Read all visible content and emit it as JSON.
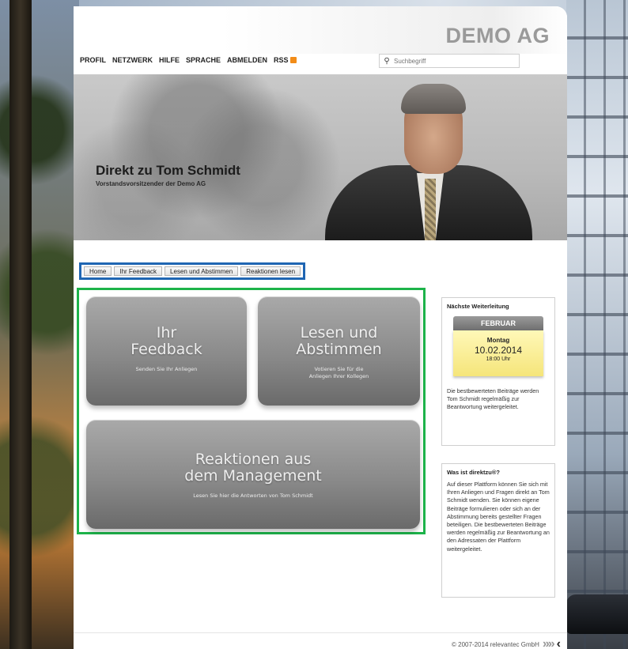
{
  "brand": {
    "logo": "DEMO AG"
  },
  "topnav": {
    "items": [
      "PROFIL",
      "NETZWERK",
      "HILFE",
      "SPRACHE",
      "ABMELDEN",
      "RSS"
    ]
  },
  "search": {
    "placeholder": "Suchbegriff",
    "icon": "search-icon"
  },
  "hero": {
    "title": "Direkt zu Tom Schmidt",
    "subtitle": "Vorstandsvorsitzender der Demo AG"
  },
  "subnav": {
    "tabs": [
      "Home",
      "Ihr Feedback",
      "Lesen und Abstimmen",
      "Reaktionen lesen"
    ]
  },
  "tiles": {
    "feedback": {
      "line1": "Ihr",
      "line2": "Feedback",
      "sub": "Senden Sie Ihr Anliegen"
    },
    "vote": {
      "line1": "Lesen und",
      "line2": "Abstimmen",
      "sub1": "Votieren Sie für die",
      "sub2": "Anliegen Ihrer Kollegen"
    },
    "reactions": {
      "line1": "Reaktionen aus",
      "line2": "dem Management",
      "sub": "Lesen Sie hier die Antworten von Tom Schmidt"
    }
  },
  "sidebar": {
    "next": {
      "heading": "Nächste Weiterleitung",
      "month": "FEBRUAR",
      "weekday": "Montag",
      "date": "10.02.2014",
      "time": "18:00 Uhr",
      "text": "Die bestbewerteten Beiträge werden Tom Schmidt regelmäßig zur Beantwortung weitergeleitet."
    },
    "what": {
      "heading": "Was ist direktzu®?",
      "text": "Auf dieser Plattform können Sie sich mit Ihren Anliegen und Fragen direkt an Tom Schmidt wenden. Sie können eigene Beiträge formulieren oder sich an der Abstimmung bereits gestellter Fragen beteiligen. Die bestbewerteten Beiträge werden regelmäßig zur Beantwortung an den Adressaten der Plattform weitergeleitet."
    }
  },
  "footer": {
    "copyright": "© 2007-2014 relevantec GmbH",
    "arrows": "»»",
    "arrow_dark": "‹"
  },
  "colors": {
    "subnav_border": "#1f66b3",
    "tiles_border": "#1db34a",
    "rss": "#f28c18"
  }
}
